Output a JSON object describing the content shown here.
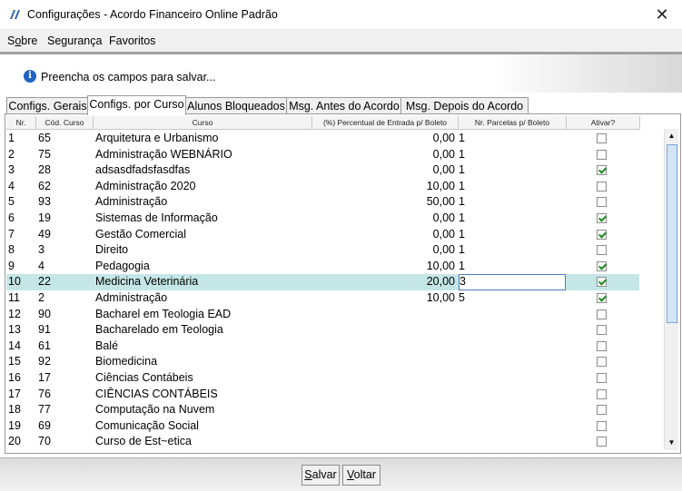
{
  "window": {
    "title": "Configurações - Acordo Financeiro Online Padrão",
    "close_icon": "close-icon",
    "app_icon": "app-logo-icon"
  },
  "menu": {
    "items": [
      {
        "label": "Sobre",
        "mnemonic": "o"
      },
      {
        "label": "Segurança"
      },
      {
        "label": "Favoritos"
      }
    ]
  },
  "info": {
    "icon": "info-icon",
    "message": "Preencha os campos para salvar..."
  },
  "tabs": [
    {
      "label": "Configs. Gerais",
      "active": false
    },
    {
      "label": "Configs. por Curso",
      "active": true
    },
    {
      "label": "Alunos Bloqueados",
      "active": false
    },
    {
      "label": "Msg. Antes do Acordo",
      "active": false
    },
    {
      "label": "Msg. Depois do Acordo",
      "active": false
    }
  ],
  "table": {
    "columns": [
      "Nr.",
      "Cód. Curso",
      "Curso",
      "(%) Percentual de Entrada p/ Boleto",
      "Nr. Parcelas p/ Boleto",
      "Ativar?"
    ],
    "selected_row": 10,
    "rows": [
      {
        "nr": "1",
        "cod": "65",
        "curso": "Arquitetura e Urbanismo",
        "perc": "0,00",
        "parcelas": "1",
        "ativar": false
      },
      {
        "nr": "2",
        "cod": "75",
        "curso": "Administração WEBNÁRIO",
        "perc": "0,00",
        "parcelas": "1",
        "ativar": false
      },
      {
        "nr": "3",
        "cod": "28",
        "curso": "adsasdfadsfasdfas",
        "perc": "0,00",
        "parcelas": "1",
        "ativar": true
      },
      {
        "nr": "4",
        "cod": "62",
        "curso": "Administração 2020",
        "perc": "10,00",
        "parcelas": "1",
        "ativar": false
      },
      {
        "nr": "5",
        "cod": "93",
        "curso": "Administração",
        "perc": "50,00",
        "parcelas": "1",
        "ativar": false
      },
      {
        "nr": "6",
        "cod": "19",
        "curso": "Sistemas de Informação",
        "perc": "0,00",
        "parcelas": "1",
        "ativar": true
      },
      {
        "nr": "7",
        "cod": "49",
        "curso": "Gestão Comercial",
        "perc": "0,00",
        "parcelas": "1",
        "ativar": true
      },
      {
        "nr": "8",
        "cod": "3",
        "curso": "Direito",
        "perc": "0,00",
        "parcelas": "1",
        "ativar": false
      },
      {
        "nr": "9",
        "cod": "4",
        "curso": "Pedagogia",
        "perc": "10,00",
        "parcelas": "1",
        "ativar": true
      },
      {
        "nr": "10",
        "cod": "22",
        "curso": "Medicina Veterinária",
        "perc": "20,00",
        "parcelas": "3",
        "ativar": true
      },
      {
        "nr": "11",
        "cod": "2",
        "curso": "Administração",
        "perc": "10,00",
        "parcelas": "5",
        "ativar": true
      },
      {
        "nr": "12",
        "cod": "90",
        "curso": "Bacharel em Teologia EAD",
        "perc": "",
        "parcelas": "",
        "ativar": false
      },
      {
        "nr": "13",
        "cod": "91",
        "curso": "Bacharelado em Teologia",
        "perc": "",
        "parcelas": "",
        "ativar": false
      },
      {
        "nr": "14",
        "cod": "61",
        "curso": "Balé",
        "perc": "",
        "parcelas": "",
        "ativar": false
      },
      {
        "nr": "15",
        "cod": "92",
        "curso": "Biomedicina",
        "perc": "",
        "parcelas": "",
        "ativar": false
      },
      {
        "nr": "16",
        "cod": "17",
        "curso": "Ciências Contábeis",
        "perc": "",
        "parcelas": "",
        "ativar": false
      },
      {
        "nr": "17",
        "cod": "76",
        "curso": "CIÊNCIAS CONTÁBEIS",
        "perc": "",
        "parcelas": "",
        "ativar": false
      },
      {
        "nr": "18",
        "cod": "77",
        "curso": "Computação na Nuvem",
        "perc": "",
        "parcelas": "",
        "ativar": false
      },
      {
        "nr": "19",
        "cod": "69",
        "curso": "Comunicação Social",
        "perc": "",
        "parcelas": "",
        "ativar": false
      },
      {
        "nr": "20",
        "cod": "70",
        "curso": "Curso de Est~etica",
        "perc": "",
        "parcelas": "",
        "ativar": false
      }
    ]
  },
  "buttons": {
    "save": "Salvar",
    "back": "Voltar"
  },
  "colors": {
    "selected_row": "#c5e6e6",
    "check": "#1e8a1e",
    "info_icon": "#1e63c4"
  }
}
